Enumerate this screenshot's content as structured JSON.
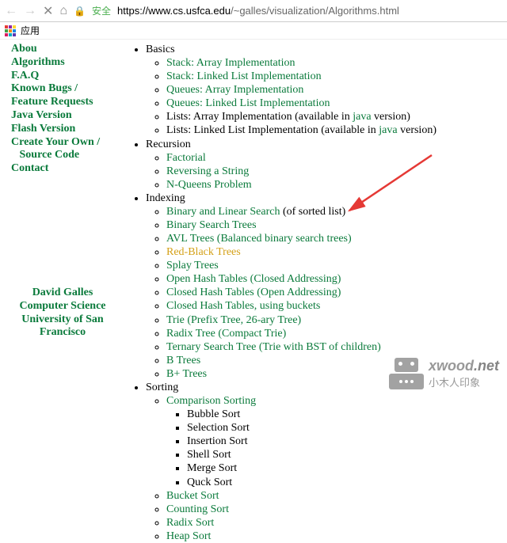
{
  "browser": {
    "secure_label": "安全",
    "url_host": "https://www.cs.usfca.edu",
    "url_path": "/~galles/visualization/Algorithms.html",
    "apps_label": "应用"
  },
  "sidebar": {
    "items": [
      "Abou",
      "Algorithms",
      "F.A.Q",
      "Known Bugs / Feature Requests",
      "Java Version",
      "Flash Version",
      "Create Your Own /",
      "   Source Code",
      "Contact"
    ]
  },
  "attribution": {
    "l1": "David Galles",
    "l2": "Computer Science",
    "l3": "University of San",
    "l4": "Francisco"
  },
  "main": {
    "basics": {
      "label": "Basics",
      "items": [
        {
          "t": "Stack: Array Implementation"
        },
        {
          "t": "Stack: Linked List Implementation"
        },
        {
          "t": "Queues: Array Implementation"
        },
        {
          "t": "Queues: Linked List Implementation"
        },
        {
          "pre": "Lists: Array Implementation",
          "mid": " (available in ",
          "link": "java",
          "post": " version)"
        },
        {
          "pre": "Lists: Linked List Implementation",
          "mid": " (available in ",
          "link": "java",
          "post": " version)"
        }
      ]
    },
    "recursion": {
      "label": "Recursion",
      "items": [
        "Factorial",
        "Reversing a String",
        "N-Queens Problem"
      ]
    },
    "indexing": {
      "label": "Indexing",
      "items": [
        {
          "t": "Binary and Linear Search",
          "p": " (of sorted list)"
        },
        {
          "t": "Binary Search Trees"
        },
        {
          "t": "AVL Trees (Balanced binary search trees)"
        },
        {
          "t": "Red-Black Trees",
          "hl": true
        },
        {
          "t": "Splay Trees"
        },
        {
          "t": "Open Hash Tables (Closed Addressing)"
        },
        {
          "t": "Closed Hash Tables (Open Addressing)"
        },
        {
          "t": "Closed Hash Tables, using buckets"
        },
        {
          "t": "Trie (Prefix Tree, 26-ary Tree)"
        },
        {
          "t": "Radix Tree (Compact Trie)"
        },
        {
          "t": "Ternary Search Tree (Trie with BST of children)"
        },
        {
          "t": "B Trees"
        },
        {
          "t": "B+ Trees"
        }
      ]
    },
    "sorting": {
      "label": "Sorting",
      "comparison": {
        "label": "Comparison Sorting",
        "items": [
          "Bubble Sort",
          "Selection Sort",
          "Insertion Sort",
          "Shell Sort",
          "Merge Sort",
          "Quck Sort"
        ]
      },
      "rest": [
        "Bucket Sort",
        "Counting Sort",
        "Radix Sort",
        "Heap Sort"
      ]
    }
  },
  "watermark": {
    "t1a": "xwood",
    "t1b": ".net",
    "t2": "小木人印象"
  }
}
